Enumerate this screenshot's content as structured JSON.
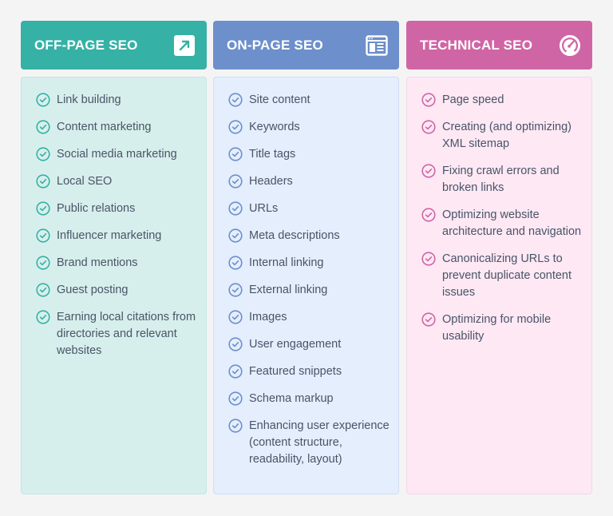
{
  "columns": [
    {
      "id": "off-page",
      "title": "OFF-PAGE SEO",
      "icon": "external-arrow-icon",
      "accent": "#35b1a5",
      "items": [
        "Link building",
        "Content marketing",
        "Social media marketing",
        "Local SEO",
        "Public relations",
        "Influencer marketing",
        "Brand mentions",
        "Guest posting",
        "Earning local citations from directories and relevant websites"
      ]
    },
    {
      "id": "on-page",
      "title": "ON-PAGE SEO",
      "icon": "webpage-layout-icon",
      "accent": "#6d8fcb",
      "items": [
        "Site content",
        "Keywords",
        "Title tags",
        "Headers",
        "URLs",
        "Meta descriptions",
        "Internal linking",
        "External linking",
        "Images",
        "User engagement",
        "Featured snippets",
        "Schema markup",
        "Enhancing user experience (content structure, readability, layout)"
      ]
    },
    {
      "id": "technical",
      "title": "TECHNICAL SEO",
      "icon": "speedometer-icon",
      "accent": "#d065a5",
      "items": [
        "Page speed",
        "Creating (and optimizing) XML sitemap",
        "Fixing crawl errors and broken links",
        "Optimizing website architecture and navigation",
        "Canonicalizing URLs to prevent duplicate content issues",
        "Optimizing for mobile usability"
      ]
    }
  ]
}
